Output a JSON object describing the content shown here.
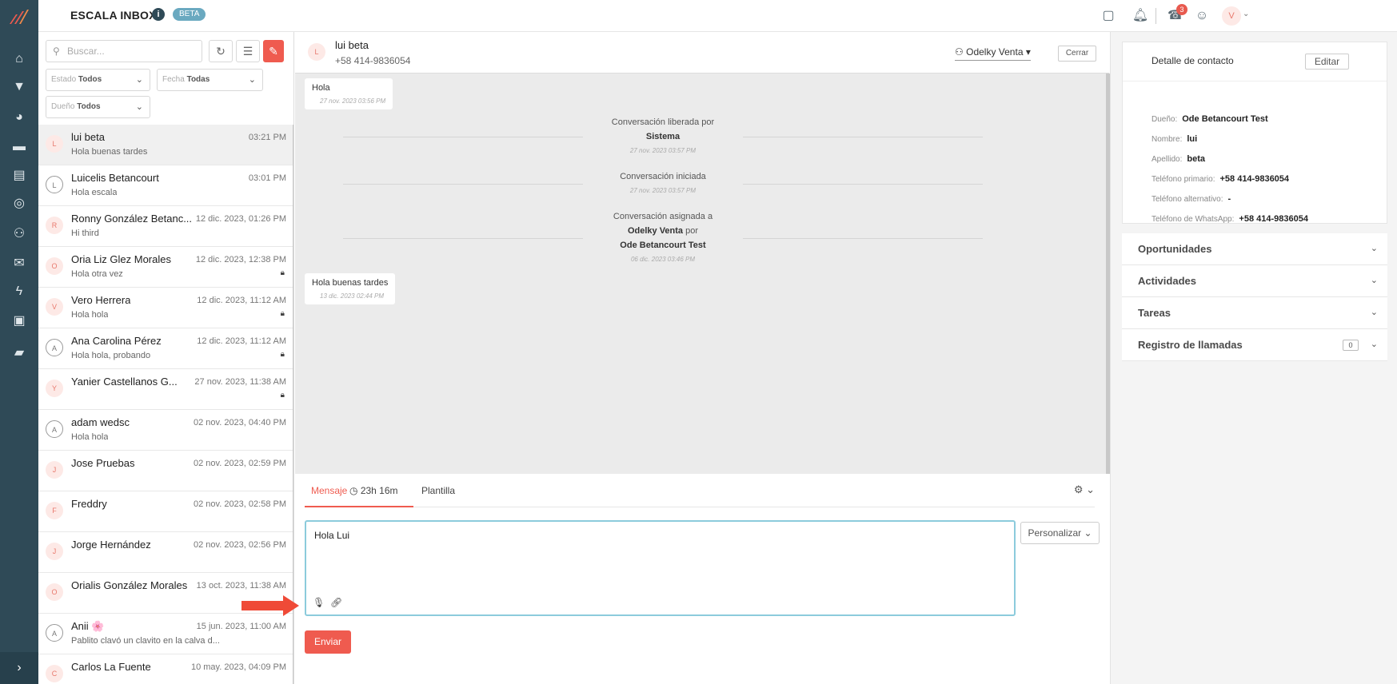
{
  "app": {
    "title": "ESCALA INBOX",
    "badge": "BETA",
    "info": "i"
  },
  "topbar": {
    "notification_count": "3",
    "user_initial": "V"
  },
  "conversations": {
    "search_placeholder": "Buscar...",
    "filters": {
      "estado": {
        "label": "Estado",
        "value": "Todos"
      },
      "fecha": {
        "label": "Fecha",
        "value": "Todas"
      },
      "dueno": {
        "label": "Dueño",
        "value": "Todos"
      }
    },
    "items": [
      {
        "initial": "L",
        "name": "lui beta",
        "time": "03:21 PM",
        "preview": "Hola buenas tardes",
        "locked": false,
        "grey": false,
        "active": true
      },
      {
        "initial": "L",
        "name": "Luicelis Betancourt",
        "time": "03:01 PM",
        "preview": "Hola escala",
        "locked": false,
        "grey": true,
        "active": false
      },
      {
        "initial": "R",
        "name": "Ronny González Betanc...",
        "time": "12 dic. 2023, 01:26 PM",
        "preview": "Hi third",
        "locked": false,
        "grey": false,
        "active": false
      },
      {
        "initial": "O",
        "name": "Oria Liz Glez Morales",
        "time": "12 dic. 2023, 12:38 PM",
        "preview": "Hola otra vez",
        "locked": true,
        "grey": false,
        "active": false
      },
      {
        "initial": "V",
        "name": "Vero Herrera",
        "time": "12 dic. 2023, 11:12 AM",
        "preview": "Hola hola",
        "locked": true,
        "grey": false,
        "active": false
      },
      {
        "initial": "A",
        "name": "Ana Carolina Pérez",
        "time": "12 dic. 2023, 11:12 AM",
        "preview": "Hola hola, probando",
        "locked": true,
        "grey": true,
        "active": false
      },
      {
        "initial": "Y",
        "name": "Yanier Castellanos G...",
        "time": "27 nov. 2023, 11:38 AM",
        "preview": "",
        "locked": true,
        "grey": false,
        "active": false
      },
      {
        "initial": "A",
        "name": "adam wedsc",
        "time": "02 nov. 2023, 04:40 PM",
        "preview": "Hola hola",
        "locked": false,
        "grey": true,
        "active": false
      },
      {
        "initial": "J",
        "name": "Jose Pruebas",
        "time": "02 nov. 2023, 02:59 PM",
        "preview": "",
        "locked": false,
        "grey": false,
        "active": false
      },
      {
        "initial": "F",
        "name": "Freddry",
        "time": "02 nov. 2023, 02:58 PM",
        "preview": "",
        "locked": false,
        "grey": false,
        "active": false
      },
      {
        "initial": "J",
        "name": "Jorge Hernández",
        "time": "02 nov. 2023, 02:56 PM",
        "preview": "",
        "locked": false,
        "grey": false,
        "active": false
      },
      {
        "initial": "O",
        "name": "Orialis González Morales",
        "time": "13 oct. 2023, 11:38 AM",
        "preview": "",
        "locked": false,
        "grey": false,
        "active": false
      },
      {
        "initial": "A",
        "name": "Anii 🌸",
        "time": "15 jun. 2023, 11:00 AM",
        "preview": "Pablito clavó un clavito en la calva d...",
        "locked": false,
        "grey": true,
        "active": false
      },
      {
        "initial": "C",
        "name": "Carlos La Fuente",
        "time": "10 may. 2023, 04:09 PM",
        "preview": "",
        "locked": false,
        "grey": false,
        "active": false
      }
    ]
  },
  "chat": {
    "contact_initial": "L",
    "contact_name": "lui beta",
    "contact_phone": "+58 414-9836054",
    "assignee": "Odelky Venta",
    "close_label": "Cerrar",
    "messages": [
      {
        "text": "Hola",
        "date": "27 nov. 2023 03:56 PM"
      },
      {
        "text": "Hola buenas tardes",
        "date": "13 dic. 2023 02:44 PM"
      }
    ],
    "system_events": [
      {
        "line1": "Conversación liberada por",
        "bold": "Sistema",
        "date": "27 nov. 2023 03:57 PM"
      },
      {
        "line1": "Conversación iniciada",
        "date": "27 nov. 2023 03:57 PM"
      },
      {
        "line1": "Conversación asignada a",
        "bold_a": "Odelky Venta",
        "por": "por",
        "bold_b": "Ode Betancourt Test",
        "date": "06 dic. 2023 03:46 PM"
      }
    ]
  },
  "composer": {
    "tab_message": "Mensaje",
    "timer": "23h 16m",
    "tab_template": "Plantilla",
    "draft": "Hola Lui",
    "personalize": "Personalizar",
    "send": "Enviar"
  },
  "contact_panel": {
    "title": "Detalle de contacto",
    "edit": "Editar",
    "fields": [
      {
        "label": "Dueño:",
        "value": "Ode Betancourt Test"
      },
      {
        "label": "Nombre:",
        "value": "lui"
      },
      {
        "label": "Apellido:",
        "value": "beta"
      },
      {
        "label": "Teléfono primario:",
        "value": "+58 414-9836054"
      },
      {
        "label": "Teléfono alternativo:",
        "value": "-"
      },
      {
        "label": "Teléfono de WhatsApp:",
        "value": "+58 414-9836054"
      }
    ],
    "sections": [
      {
        "label": "Oportunidades"
      },
      {
        "label": "Actividades"
      },
      {
        "label": "Tareas"
      },
      {
        "label": "Registro de llamadas",
        "count": "0"
      }
    ]
  },
  "colors": {
    "accent": "#ef5b4f",
    "rail": "#2f4a57",
    "focus": "#8ccbdc"
  }
}
